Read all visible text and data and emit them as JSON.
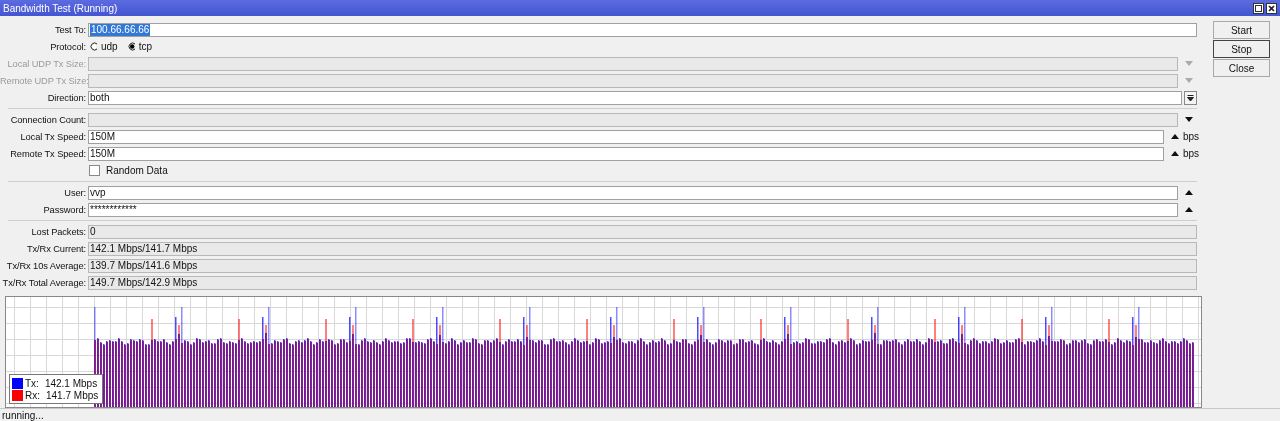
{
  "window": {
    "title": "Bandwidth Test (Running)"
  },
  "form": [
    {
      "kind": "field",
      "label": "Test To:",
      "value": "100.66.66.66",
      "highlighted": true
    },
    {
      "kind": "radio",
      "label": "Protocol:",
      "options": [
        {
          "label": "udp",
          "selected": false
        },
        {
          "label": "tcp",
          "selected": true
        }
      ]
    },
    {
      "kind": "field",
      "label": "Local UDP Tx Size:",
      "disabled": true,
      "down_arrow": true
    },
    {
      "kind": "field",
      "label": "Remote UDP Tx Size:",
      "disabled": true,
      "down_arrow": true
    },
    {
      "kind": "field",
      "label": "Direction:",
      "value": "both",
      "select_button": true
    },
    {
      "kind": "separator"
    },
    {
      "kind": "field",
      "label": "Connection Count:",
      "readonly": true,
      "down_arrow": true
    },
    {
      "kind": "field",
      "label": "Local Tx Speed:",
      "value": "150M",
      "up_arrow": true,
      "unit": "bps"
    },
    {
      "kind": "field",
      "label": "Remote Tx Speed:",
      "value": "150M",
      "up_arrow": true,
      "unit": "bps"
    },
    {
      "kind": "checkbox",
      "label": "Random Data",
      "checked": false
    },
    {
      "kind": "separator"
    },
    {
      "kind": "field",
      "label": "User:",
      "value": "vvp",
      "up_arrow": true
    },
    {
      "kind": "field",
      "label": "Password:",
      "value": "************",
      "up_arrow": true
    },
    {
      "kind": "separator"
    },
    {
      "kind": "field",
      "label": "Lost Packets:",
      "value": "0",
      "readonly": true
    },
    {
      "kind": "field",
      "label": "Tx/Rx Current:",
      "value": "142.1 Mbps/141.7 Mbps",
      "readonly": true
    },
    {
      "kind": "field",
      "label": "Tx/Rx 10s Average:",
      "value": "139.7 Mbps/141.6 Mbps",
      "readonly": true
    },
    {
      "kind": "field",
      "label": "Tx/Rx Total Average:",
      "value": "149.7 Mbps/142.9 Mbps",
      "readonly": true
    }
  ],
  "buttons": [
    {
      "label": "Start",
      "focused": false
    },
    {
      "label": "Stop",
      "focused": true
    },
    {
      "label": "Close",
      "focused": false
    }
  ],
  "graph": {
    "legend": [
      {
        "label": "Tx:",
        "value": "142.1 Mbps",
        "color": "#0000ff"
      },
      {
        "label": "Rx:",
        "value": "141.7 Mbps",
        "color": "#ff0000"
      }
    ]
  },
  "status_bar": "running..."
}
